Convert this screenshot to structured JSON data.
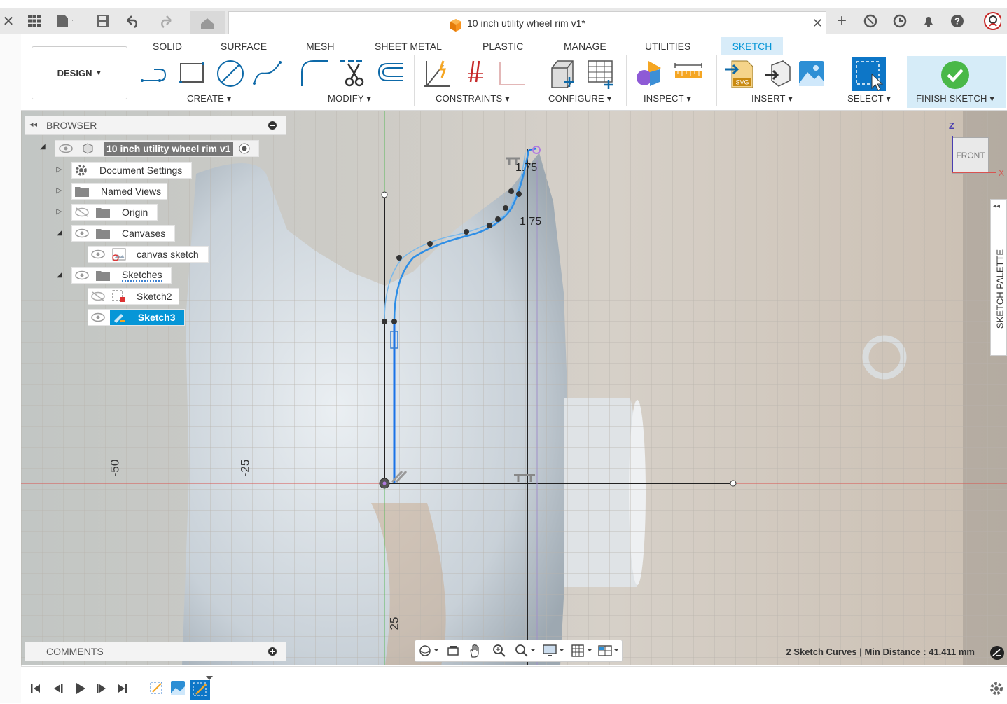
{
  "window": {
    "doc_title": "10 inch utility wheel rim v1*"
  },
  "ribbon": {
    "workspace": "DESIGN",
    "tabs": [
      "SOLID",
      "SURFACE",
      "MESH",
      "SHEET METAL",
      "PLASTIC",
      "MANAGE",
      "UTILITIES",
      "SKETCH"
    ],
    "active_tab": "SKETCH",
    "groups": {
      "create": "CREATE",
      "modify": "MODIFY",
      "constraints": "CONSTRAINTS",
      "configure": "CONFIGURE",
      "inspect": "INSPECT",
      "insert": "INSERT",
      "select": "SELECT",
      "finish": "FINISH SKETCH"
    },
    "accent": "#0696d7",
    "finish_color": "#49b848"
  },
  "browser": {
    "title": "BROWSER",
    "root": "10 inch utility wheel rim v1",
    "items": [
      {
        "label": "Document Settings"
      },
      {
        "label": "Named Views"
      },
      {
        "label": "Origin"
      },
      {
        "label": "Canvases"
      },
      {
        "label": "canvas sketch"
      },
      {
        "label": "Sketches"
      },
      {
        "label": "Sketch2"
      },
      {
        "label": "Sketch3"
      }
    ],
    "selected": "Sketch3"
  },
  "viewcube": {
    "face": "FRONT",
    "z_label": "Z",
    "x_label": "X"
  },
  "sketch": {
    "dim_top": "1.75",
    "dim_right": "1.75",
    "ruler_labels": [
      "-50",
      "-25",
      "25"
    ]
  },
  "palette": {
    "label": "SKETCH PALETTE"
  },
  "comments": {
    "label": "COMMENTS"
  },
  "status": {
    "text": "2 Sketch Curves | Min Distance : 41.411 mm"
  }
}
